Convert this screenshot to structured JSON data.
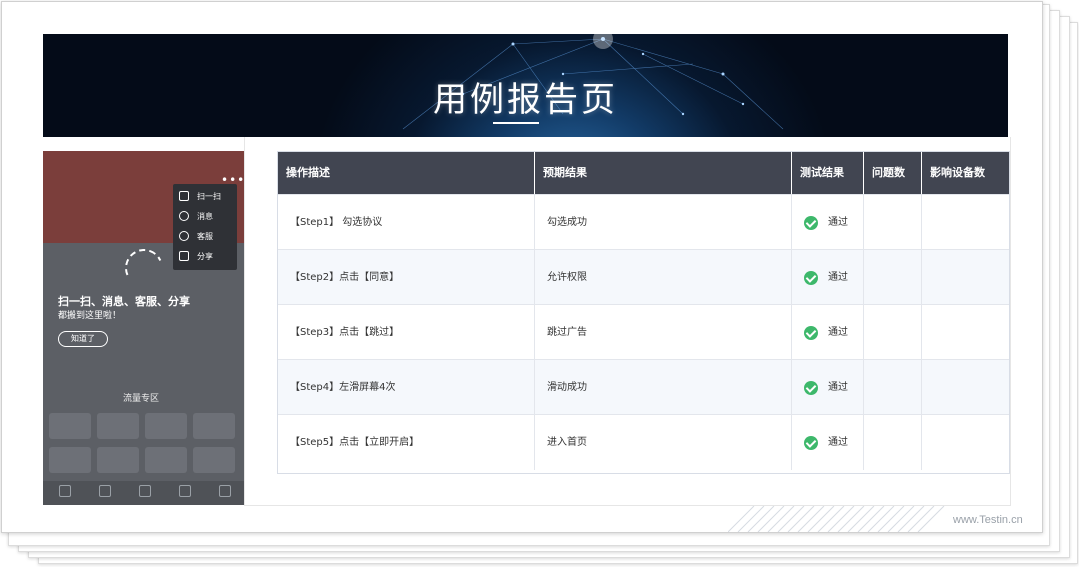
{
  "banner": {
    "title": "用例报告页"
  },
  "phone": {
    "menu": [
      {
        "label": "扫一扫",
        "icon": "scan-icon"
      },
      {
        "label": "消息",
        "icon": "message-icon"
      },
      {
        "label": "客服",
        "icon": "customer-service-icon"
      },
      {
        "label": "分享",
        "icon": "share-icon"
      }
    ],
    "hint_title": "扫一扫、消息、客服、分享",
    "hint_sub": "都搬到这里啦！",
    "got_it": "知道了",
    "zone_title": "流量专区"
  },
  "table": {
    "headers": [
      "操作描述",
      "预期结果",
      "测试结果",
      "问题数",
      "影响设备数"
    ],
    "rows": [
      {
        "step": "【Step1】 勾选协议",
        "expected": "勾选成功",
        "result": "通过",
        "issues": "",
        "devices": ""
      },
      {
        "step": "【Step2】点击【同意】",
        "expected": "允许权限",
        "result": "通过",
        "issues": "",
        "devices": ""
      },
      {
        "step": "【Step3】点击【跳过】",
        "expected": "跳过广告",
        "result": "通过",
        "issues": "",
        "devices": ""
      },
      {
        "step": "【Step4】左滑屏幕4次",
        "expected": "滑动成功",
        "result": "通过",
        "issues": "",
        "devices": ""
      },
      {
        "step": "【Step5】点击【立即开启】",
        "expected": "进入首页",
        "result": "通过",
        "issues": "",
        "devices": ""
      }
    ]
  },
  "footer": {
    "watermark": "www.Testin.cn"
  },
  "colors": {
    "header_bg": "#414551",
    "pass": "#3db86b",
    "alt_row": "#f5f8fc"
  }
}
